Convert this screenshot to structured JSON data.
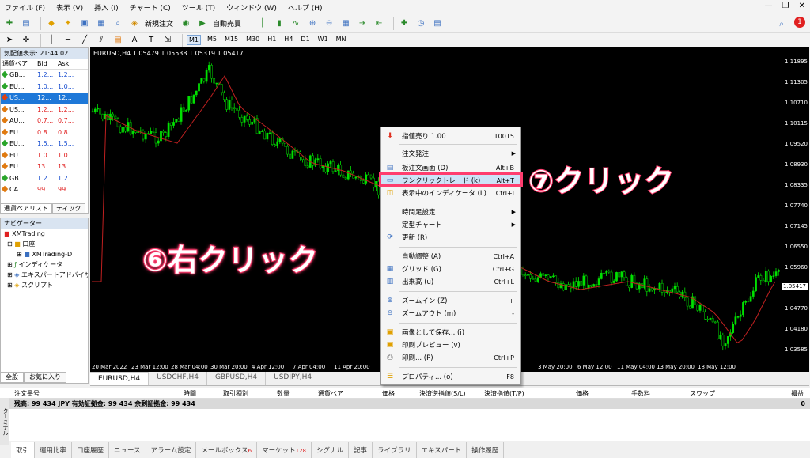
{
  "menubar": {
    "items": [
      "ファイル (F)",
      "表示 (V)",
      "挿入 (I)",
      "チャート (C)",
      "ツール (T)",
      "ウィンドウ (W)",
      "ヘルプ (H)"
    ]
  },
  "toolbar": {
    "new_order": "新規注文",
    "auto_trading": "自動売買",
    "timeframes": [
      "M1",
      "M5",
      "M15",
      "M30",
      "H1",
      "H4",
      "D1",
      "W1",
      "MN"
    ],
    "active_timeframe": "M1",
    "notification_count": "1"
  },
  "market_watch": {
    "title": "気配値表示: 21:44:02",
    "headers": [
      "通貨ペア",
      "Bid",
      "Ask"
    ],
    "rows": [
      {
        "sym": "GB...",
        "bid": "1.2...",
        "ask": "1.2...",
        "color": "blue",
        "dot": "#2aa52a"
      },
      {
        "sym": "EU...",
        "bid": "1.0...",
        "ask": "1.0...",
        "color": "blue",
        "dot": "#2aa52a"
      },
      {
        "sym": "US...",
        "bid": "12...",
        "ask": "12...",
        "color": "sel",
        "dot": "#e04010"
      },
      {
        "sym": "US...",
        "bid": "1.2...",
        "ask": "1.2...",
        "color": "red",
        "dot": "#e07a10"
      },
      {
        "sym": "AU...",
        "bid": "0.7...",
        "ask": "0.7...",
        "color": "red",
        "dot": "#e07a10"
      },
      {
        "sym": "EU...",
        "bid": "0.8...",
        "ask": "0.8...",
        "color": "red",
        "dot": "#e07a10"
      },
      {
        "sym": "EU...",
        "bid": "1.5...",
        "ask": "1.5...",
        "color": "blue",
        "dot": "#2aa52a"
      },
      {
        "sym": "EU...",
        "bid": "1.0...",
        "ask": "1.0...",
        "color": "red",
        "dot": "#e07a10"
      },
      {
        "sym": "EU...",
        "bid": "13...",
        "ask": "13...",
        "color": "red",
        "dot": "#e07a10"
      },
      {
        "sym": "GB...",
        "bid": "1.2...",
        "ask": "1.2...",
        "color": "blue",
        "dot": "#2aa52a"
      },
      {
        "sym": "CA...",
        "bid": "99...",
        "ask": "99...",
        "color": "red",
        "dot": "#e07a10"
      }
    ],
    "tabs": [
      "通貨ペアリスト",
      "ティック"
    ]
  },
  "navigator": {
    "title": "ナビゲーター",
    "items": [
      "XMTrading",
      "口座",
      "XMTrading-D",
      "インディケータ",
      "エキスパートアドバイザ",
      "スクリプト"
    ],
    "tabs": [
      "全般",
      "お気に入り"
    ]
  },
  "chart": {
    "header": "EURUSD,H4  1.05479 1.05538 1.05319 1.05417",
    "price_labels": [
      "1.11895",
      "1.11305",
      "1.10710",
      "1.10115",
      "1.09520",
      "1.08930",
      "1.08335",
      "1.07740",
      "1.07145",
      "1.06550",
      "1.05960",
      "1.04770",
      "1.04180",
      "1.03585"
    ],
    "current_price": "1.05417",
    "date_labels": [
      "20 Mar 2022",
      "23 Mar 12:00",
      "28 Mar 04:00",
      "30 Mar 20:00",
      "4 Apr 12:00",
      "7 Apr 04:00",
      "11 Apr 20:00",
      "3 May 20:00",
      "6 May 12:00",
      "11 May 04:00",
      "13 May 20:00",
      "18 May 12:00"
    ],
    "tabs": [
      "EURUSD,H4",
      "USDCHF,H4",
      "GBPUSD,H4",
      "USDJPY,H4"
    ],
    "active_tab": "EURUSD,H4"
  },
  "context_menu": {
    "items": [
      {
        "label": "指値売り 1.00",
        "key": "1.10015",
        "icon": "sell"
      },
      {
        "label": "注文発注",
        "key": "",
        "arrow": true
      },
      {
        "label": "板注文画面 (D)",
        "key": "Alt+B",
        "icon": "board"
      },
      {
        "label": "ワンクリックトレード (k)",
        "key": "Alt+T",
        "icon": "oneclick",
        "highlight": true
      },
      {
        "label": "表示中のインディケータ (L)",
        "key": "Ctrl+I",
        "icon": "indicator"
      },
      {
        "label": "時間足設定",
        "key": "",
        "arrow": true
      },
      {
        "label": "定型チャート",
        "key": "",
        "arrow": true
      },
      {
        "label": "更新 (R)",
        "key": "",
        "icon": "refresh"
      },
      {
        "label": "自動調整 (A)",
        "key": "Ctrl+A"
      },
      {
        "label": "グリッド (G)",
        "key": "Ctrl+G",
        "icon": "grid"
      },
      {
        "label": "出来高 (u)",
        "key": "Ctrl+L",
        "icon": "volume"
      },
      {
        "label": "ズームイン (Z)",
        "key": "+",
        "icon": "zoomin"
      },
      {
        "label": "ズームアウト (m)",
        "key": "-",
        "icon": "zoomout"
      },
      {
        "label": "画像として保存... (i)",
        "key": "",
        "icon": "save"
      },
      {
        "label": "印刷プレビュー (v)",
        "key": "",
        "icon": "preview"
      },
      {
        "label": "印刷... (P)",
        "key": "Ctrl+P",
        "icon": "print"
      },
      {
        "label": "プロパティ... (o)",
        "key": "F8",
        "icon": "props"
      }
    ]
  },
  "annotations": {
    "right_click": "⑥右クリック",
    "click": "⑦クリック"
  },
  "terminal": {
    "side_label": "ターミナル",
    "headers": [
      "注文番号",
      "時間",
      "取引種別",
      "数量",
      "通貨ペア",
      "価格",
      "決済逆指値(S/L)",
      "決済指値(T/P)",
      "価格",
      "手数料",
      "スワップ",
      "損益"
    ],
    "balance_text": "残高: 99 434 JPY  有効証拠金: 99 434  余剰証拠金: 99 434",
    "balance_value": "0",
    "tabs": [
      "取引",
      "運用比率",
      "口座履歴",
      "ニュース",
      "アラーム設定",
      "メールボックス",
      "マーケット",
      "シグナル",
      "記事",
      "ライブラリ",
      "エキスパート",
      "操作履歴"
    ],
    "mailbox_count": "6",
    "market_count": "128"
  },
  "colors": {
    "candle": "#00e000",
    "ma_line": "#c02020",
    "highlight": "#ff3d6e",
    "selection": "#1e78d8"
  }
}
